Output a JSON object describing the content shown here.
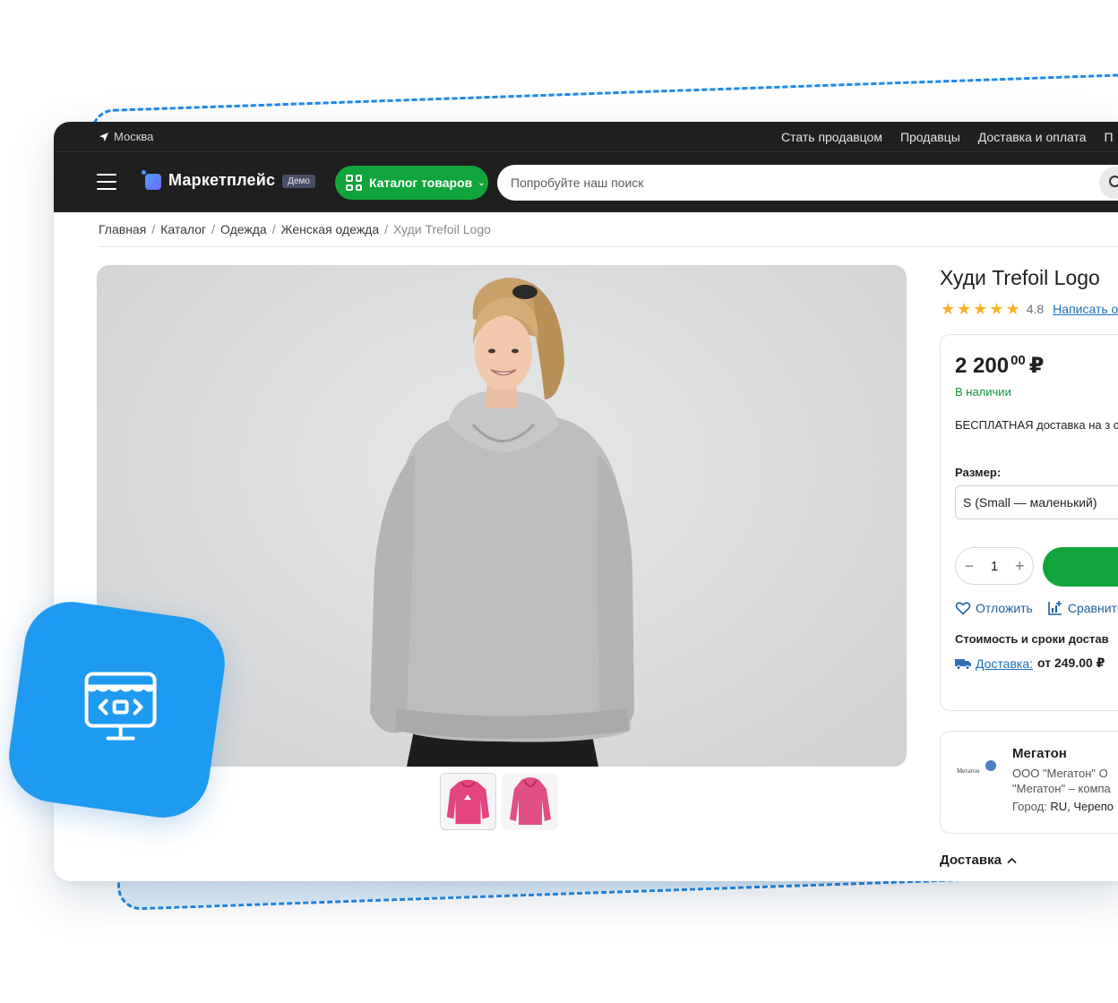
{
  "topbar": {
    "city": "Москва",
    "links": [
      "Стать продавцом",
      "Продавцы",
      "Доставка и оплата",
      "П"
    ]
  },
  "header": {
    "logo_text": "Маркетплейс",
    "logo_badge": "Демо",
    "catalog_label": "Каталог товаров",
    "search_placeholder": "Попробуйте наш поиск"
  },
  "breadcrumb": [
    "Главная",
    "Каталог",
    "Одежда",
    "Женская одежда",
    "Худи Trefoil Logo"
  ],
  "product": {
    "title": "Худи Trefoil Logo",
    "rating": "4.8",
    "stars": 5,
    "review_link": "Написать о",
    "price_main": "2 200",
    "price_cents": "00",
    "currency": "₽",
    "stock": "В наличии",
    "delivery_note": "БЕСПЛАТНАЯ доставка на з суток.",
    "size_label": "Размер:",
    "size_value": "S (Small — маленький)",
    "quantity": "1",
    "stepper_minus": "−",
    "stepper_plus": "+",
    "defer_label": "Отложить",
    "compare_label": "Сравнить",
    "shipping_title": "Стоимость и сроки достав",
    "shipping_link": "Доставка:",
    "shipping_price": "от 249.00 ₽"
  },
  "seller": {
    "logo_text": "Мегатон",
    "name": "Мегатон",
    "desc": "ООО \"Мегатон\" О\n\"Мегатон\" – компа",
    "city_label": "Город:",
    "city_value": "RU, Черепо"
  },
  "delivery_section": "Доставка",
  "colors": {
    "accent_green": "#10a53a",
    "header_bg": "#1f1f1f",
    "link_blue": "#1e6fb8",
    "badge_blue": "#1e9bf0",
    "hoodie_pink": "#e2457f"
  },
  "icons": [
    "location-arrow-icon",
    "menu-icon",
    "catalog-grid-icon",
    "search-icon",
    "star-icon",
    "heart-icon",
    "compare-icon",
    "truck-icon",
    "chevron-up-icon",
    "storefront-code-icon"
  ]
}
